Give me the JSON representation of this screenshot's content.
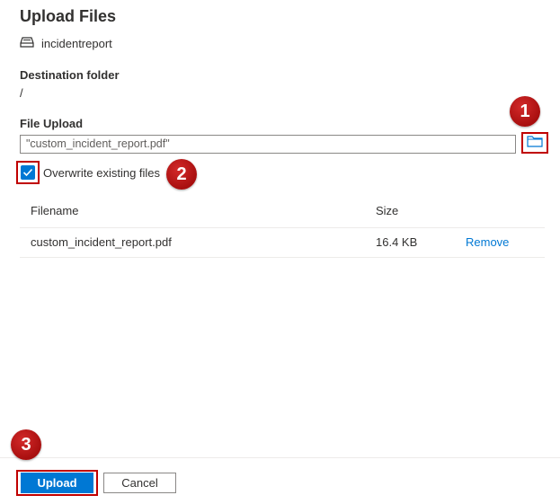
{
  "header": {
    "title": "Upload Files"
  },
  "account": {
    "icon": "storage-icon",
    "name": "incidentreport"
  },
  "destination": {
    "label": "Destination folder",
    "value": "/"
  },
  "file_upload": {
    "label": "File Upload",
    "value": "\"custom_incident_report.pdf\"",
    "browse_icon": "folder-icon"
  },
  "overwrite": {
    "label": "Overwrite existing files",
    "checked": true
  },
  "table": {
    "columns": [
      "Filename",
      "Size"
    ],
    "rows": [
      {
        "filename": "custom_incident_report.pdf",
        "size": "16.4 KB",
        "action": "Remove"
      }
    ]
  },
  "callouts": [
    "1",
    "2",
    "3"
  ],
  "footer": {
    "upload_label": "Upload",
    "cancel_label": "Cancel"
  },
  "colors": {
    "accent": "#0078d4",
    "callout": "#b31414",
    "highlight_border": "#c00000"
  }
}
